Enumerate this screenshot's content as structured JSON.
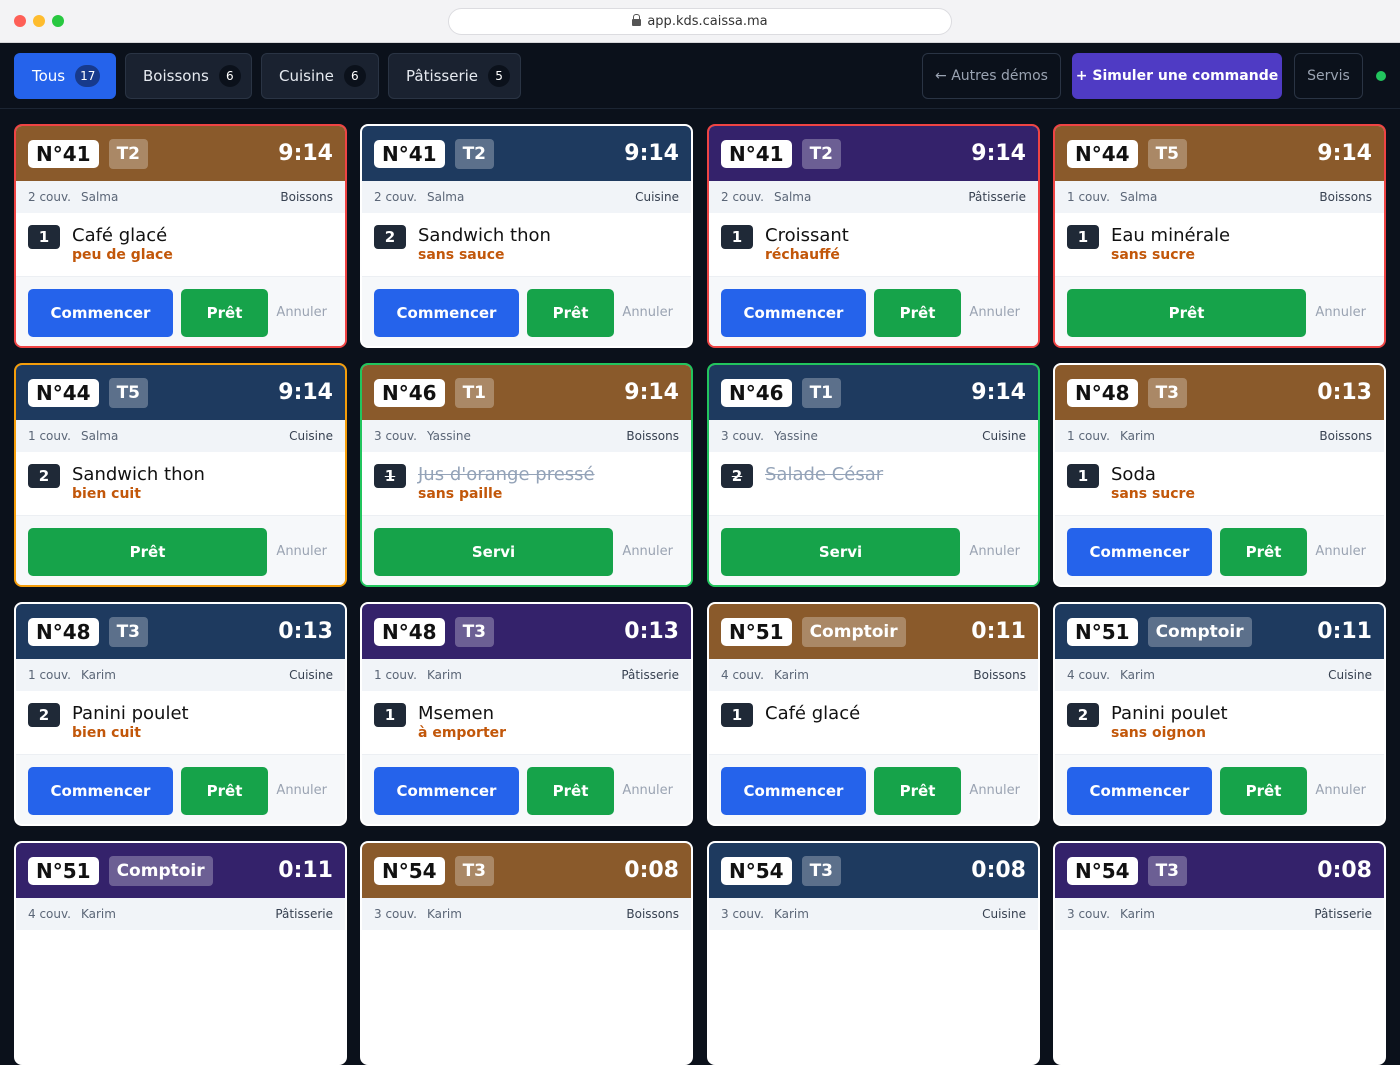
{
  "browser": {
    "url": "app.kds.caissa.ma"
  },
  "tabs": [
    {
      "label": "Tous",
      "count": "17",
      "active": true
    },
    {
      "label": "Boissons",
      "count": "6"
    },
    {
      "label": "Cuisine",
      "count": "6"
    },
    {
      "label": "Pâtisserie",
      "count": "5"
    }
  ],
  "toolbar": {
    "demos": "← Autres démos",
    "simulate": "+ Simuler une commande",
    "served": "Servis"
  },
  "labels": {
    "start": "Commencer",
    "ready": "Prêt",
    "served": "Servi",
    "cancel": "Annuler"
  },
  "colors": {
    "boissons": "#8a5a2b",
    "cuisine": "#1e3a5f",
    "patisserie": "#34226b",
    "late": "#ef4444",
    "ready": "#22c55e",
    "started": "#f59e0b"
  },
  "orders": [
    {
      "num": "N°41",
      "table": "T2",
      "time": "9:14",
      "covers": "2 couv.",
      "server": "Salma",
      "station": "Boissons",
      "qty": "1",
      "item": "Café glacé",
      "note": "peu de glace",
      "status": "new",
      "border": "red",
      "kind": "boissons"
    },
    {
      "num": "N°41",
      "table": "T2",
      "time": "9:14",
      "covers": "2 couv.",
      "server": "Salma",
      "station": "Cuisine",
      "qty": "2",
      "item": "Sandwich thon",
      "note": "sans sauce",
      "status": "new",
      "border": "white",
      "kind": "cuisine"
    },
    {
      "num": "N°41",
      "table": "T2",
      "time": "9:14",
      "covers": "2 couv.",
      "server": "Salma",
      "station": "Pâtisserie",
      "qty": "1",
      "item": "Croissant",
      "note": "réchauffé",
      "status": "new",
      "border": "red",
      "kind": "patisserie"
    },
    {
      "num": "N°44",
      "table": "T5",
      "time": "9:14",
      "covers": "1 couv.",
      "server": "Salma",
      "station": "Boissons",
      "qty": "1",
      "item": "Eau minérale",
      "note": "sans sucre",
      "status": "started",
      "border": "red",
      "kind": "boissons"
    },
    {
      "num": "N°44",
      "table": "T5",
      "time": "9:14",
      "covers": "1 couv.",
      "server": "Salma",
      "station": "Cuisine",
      "qty": "2",
      "item": "Sandwich thon",
      "note": "bien cuit",
      "status": "started",
      "border": "amber",
      "kind": "cuisine"
    },
    {
      "num": "N°46",
      "table": "T1",
      "time": "9:14",
      "covers": "3 couv.",
      "server": "Yassine",
      "station": "Boissons",
      "qty": "1",
      "item": "Jus d'orange pressé",
      "note": "sans paille",
      "status": "ready",
      "border": "green",
      "kind": "boissons"
    },
    {
      "num": "N°46",
      "table": "T1",
      "time": "9:14",
      "covers": "3 couv.",
      "server": "Yassine",
      "station": "Cuisine",
      "qty": "2",
      "item": "Salade César",
      "note": "",
      "status": "ready",
      "border": "green",
      "kind": "cuisine"
    },
    {
      "num": "N°48",
      "table": "T3",
      "time": "0:13",
      "covers": "1 couv.",
      "server": "Karim",
      "station": "Boissons",
      "qty": "1",
      "item": "Soda",
      "note": "sans sucre",
      "status": "new",
      "border": "white",
      "kind": "boissons"
    },
    {
      "num": "N°48",
      "table": "T3",
      "time": "0:13",
      "covers": "1 couv.",
      "server": "Karim",
      "station": "Cuisine",
      "qty": "2",
      "item": "Panini poulet",
      "note": "bien cuit",
      "status": "new",
      "border": "white",
      "kind": "cuisine"
    },
    {
      "num": "N°48",
      "table": "T3",
      "time": "0:13",
      "covers": "1 couv.",
      "server": "Karim",
      "station": "Pâtisserie",
      "qty": "1",
      "item": "Msemen",
      "note": "à emporter",
      "status": "new",
      "border": "white",
      "kind": "patisserie"
    },
    {
      "num": "N°51",
      "table": "Comptoir",
      "time": "0:11",
      "covers": "4 couv.",
      "server": "Karim",
      "station": "Boissons",
      "qty": "1",
      "item": "Café glacé",
      "note": "",
      "status": "new",
      "border": "white",
      "kind": "boissons"
    },
    {
      "num": "N°51",
      "table": "Comptoir",
      "time": "0:11",
      "covers": "4 couv.",
      "server": "Karim",
      "station": "Cuisine",
      "qty": "2",
      "item": "Panini poulet",
      "note": "sans oignon",
      "status": "new",
      "border": "white",
      "kind": "cuisine"
    },
    {
      "num": "N°51",
      "table": "Comptoir",
      "time": "0:11",
      "covers": "4 couv.",
      "server": "Karim",
      "station": "Pâtisserie",
      "status": "new",
      "border": "white",
      "kind": "patisserie"
    },
    {
      "num": "N°54",
      "table": "T3",
      "time": "0:08",
      "covers": "3 couv.",
      "server": "Karim",
      "station": "Boissons",
      "status": "new",
      "border": "white",
      "kind": "boissons"
    },
    {
      "num": "N°54",
      "table": "T3",
      "time": "0:08",
      "covers": "3 couv.",
      "server": "Karim",
      "station": "Cuisine",
      "status": "new",
      "border": "white",
      "kind": "cuisine"
    },
    {
      "num": "N°54",
      "table": "T3",
      "time": "0:08",
      "covers": "3 couv.",
      "server": "Karim",
      "station": "Pâtisserie",
      "status": "new",
      "border": "white",
      "kind": "patisserie"
    }
  ]
}
